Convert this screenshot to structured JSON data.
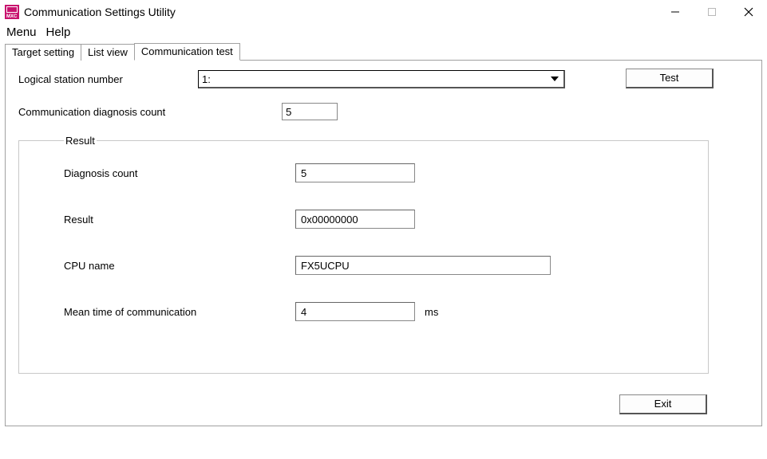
{
  "window": {
    "title": "Communication Settings Utility"
  },
  "menubar": {
    "menu": "Menu",
    "help": "Help"
  },
  "tabs": {
    "target": "Target setting",
    "list": "List view",
    "comm": "Communication test"
  },
  "form": {
    "station_label": "Logical station number",
    "station_value": "1:",
    "test_label": "Test",
    "diag_count_label": "Communication diagnosis count",
    "diag_count_value": "5"
  },
  "result": {
    "legend": "Result",
    "diag_count_label": "Diagnosis count",
    "diag_count_value": "5",
    "result_label": "Result",
    "result_value": "0x00000000",
    "cpu_label": "CPU name",
    "cpu_value": "FX5UCPU",
    "mean_label": "Mean time of communication",
    "mean_value": "4",
    "mean_unit": "ms"
  },
  "footer": {
    "exit_label": "Exit"
  }
}
